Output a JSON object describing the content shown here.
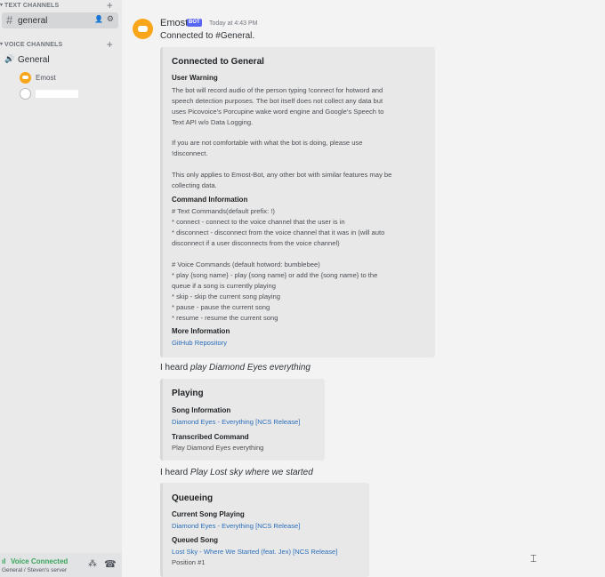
{
  "sidebar": {
    "text_category": "TEXT CHANNELS",
    "text_channel": "general",
    "voice_category": "VOICE CHANNELS",
    "voice_channel": "General",
    "voice_users": [
      {
        "name": "Emost",
        "avatar": "bot-avatar-icon"
      },
      {
        "name": "",
        "avatar": "blank-avatar-icon"
      }
    ],
    "voice_status": "Voice Connected",
    "voice_location": "General / Steven's server"
  },
  "message": {
    "author": "Emost",
    "badge": "BOT",
    "timestamp": "Today at 4:43 PM",
    "content": "Connected to #General."
  },
  "embed_connected": {
    "title": "Connected to General",
    "warning_label": "User Warning",
    "warning_lines": [
      "The bot will record audio of the person typing !connect for hotword and",
      "speech detection purposes. The bot itself does not collect any data but",
      "uses Picovoice's Porcupine wake word engine and Google's Speech to",
      "Text API w/o Data Logging.",
      "",
      "If you are not comfortable with what the bot is doing, please use",
      "!disconnect.",
      "",
      "This only applies to Emost-Bot, any other bot with similar features may be",
      "collecting data."
    ],
    "commands_label": "Command Information",
    "command_lines": [
      "# Text Commands(default prefix: !)",
      "* connect - connect to the voice channel that the user is in",
      "* disconnect - disconnect from the voice channel that it was in (will auto",
      "disconnect if a user disconnects from the voice channel)",
      "",
      "# Voice Commands (default hotword: bumblebee)",
      "* play {song name} - play {song name} or add the {song name} to the",
      "queue if a song is currently playing",
      "* skip - skip the current song playing",
      "* pause - pause the current song",
      "* resume - resume the current song"
    ],
    "more_label": "More Information",
    "more_link": "GitHub Repository"
  },
  "heard1": {
    "prefix": "I heard ",
    "phrase": "play Diamond Eyes everything"
  },
  "embed_playing": {
    "title": "Playing",
    "song_label": "Song Information",
    "song_link": "Diamond Eyes - Everything [NCS Release]",
    "cmd_label": "Transcribed Command",
    "cmd_text": "Play Diamond Eyes everything"
  },
  "heard2": {
    "prefix": "I heard ",
    "phrase": "Play Lost sky where we started"
  },
  "embed_queue": {
    "title": "Queueing",
    "current_label": "Current Song Playing",
    "current_link": "Diamond Eyes - Everything [NCS Release]",
    "queued_label": "Queued Song",
    "queued_link": "Lost Sky - Where We Started (feat. Jex) [NCS Release]",
    "position": "Position #1"
  },
  "colors": {
    "bot_badge": "#5865f2",
    "link": "#2c6fbb",
    "voice_connected": "#3ba55c",
    "avatar": "#faa61a"
  }
}
